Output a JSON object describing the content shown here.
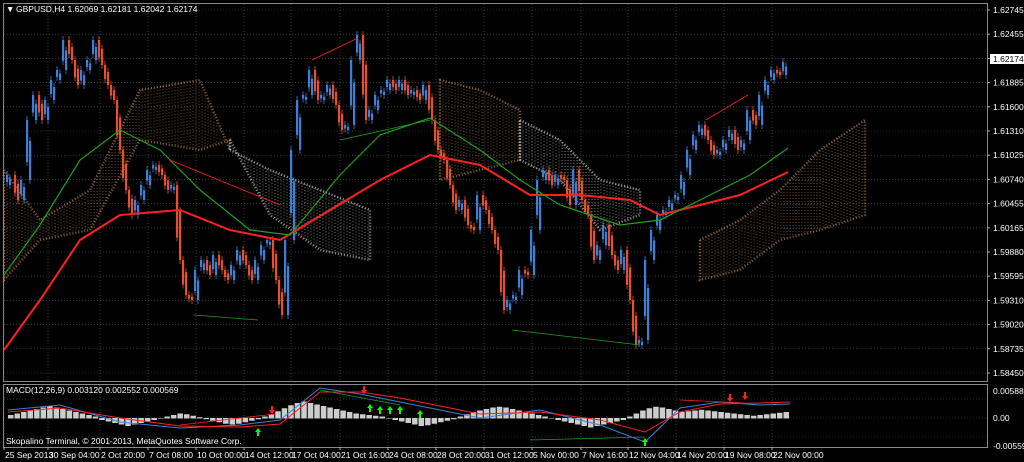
{
  "main_chart": {
    "title": "GBPUSD,H4  1.62069 1.62181 1.62042 1.62174",
    "current_price": "1.62174",
    "price_labels": [
      "1.62745",
      "1.62455",
      "1.62174",
      "1.61885",
      "1.61600",
      "1.61310",
      "1.61025",
      "1.60740",
      "1.60455",
      "1.60165",
      "1.59880",
      "1.59595",
      "1.59310",
      "1.59020",
      "1.58735",
      "1.58450"
    ]
  },
  "macd": {
    "title": "MACD(12,26,9) 0.003120 0.002552 0.000569",
    "labels": [
      "0.005887",
      "0.00",
      "-0.005596"
    ]
  },
  "footer": {
    "copyright": "Skopalino Terminal, © 2001-2013, MetaQuotes Software Corp."
  },
  "time_labels": [
    "25 Sep 2013",
    "30 Sep 04:00",
    "2 Oct 20:00",
    "7 Oct 08:00",
    "10 Oct 00:00",
    "14 Oct 12:00",
    "17 Oct 04:00",
    "21 Oct 16:00",
    "24 Oct 08:00",
    "28 Oct 20:00",
    "31 Oct 12:00",
    "5 Nov 00:00",
    "7 Nov 16:00",
    "12 Nov 04:00",
    "14 Nov 20:00",
    "19 Nov 08:00",
    "22 Nov 00:00"
  ],
  "colors": {
    "background": "#000000",
    "grid": "#5a5a5a",
    "bull_candle": "#3d7fd9",
    "bear_candle": "#e8502a",
    "ma_fast": "#1f9e1f",
    "ma_slow": "#ff2020",
    "cloud_bull": "#c88a5a",
    "cloud_bear": "#e0e0e0",
    "macd_hist": "#cccccc",
    "macd_line": "#3d7fd9",
    "signal_line": "#ff2020",
    "arrow_up": "#00ff00",
    "arrow_down": "#ff2020"
  }
}
